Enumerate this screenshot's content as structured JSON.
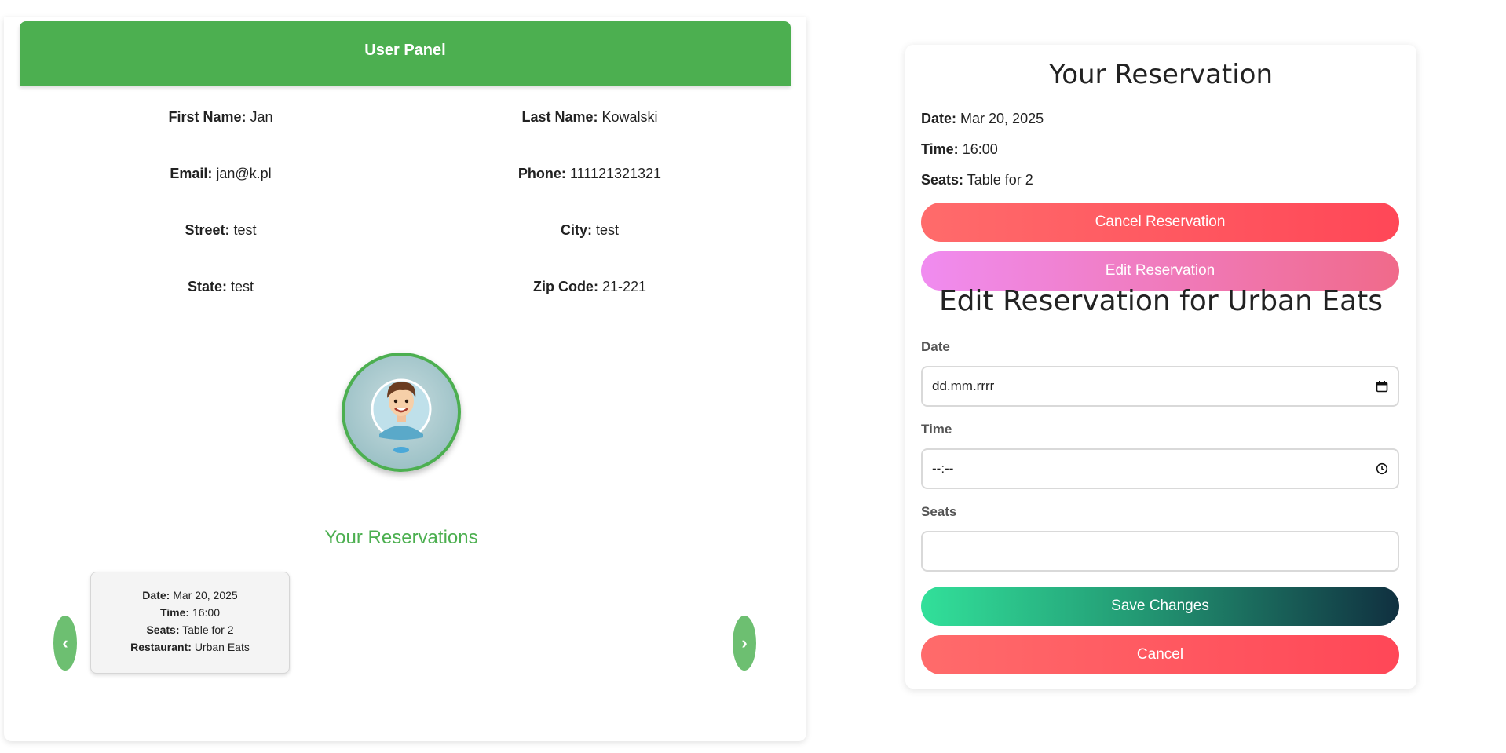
{
  "user_panel": {
    "header": "User Panel",
    "fields": [
      {
        "label": "First Name:",
        "value": "Jan"
      },
      {
        "label": "Last Name:",
        "value": "Kowalski"
      },
      {
        "label": "Email:",
        "value": "jan@k.pl"
      },
      {
        "label": "Phone:",
        "value": "111121321321"
      },
      {
        "label": "Street:",
        "value": "test"
      },
      {
        "label": "City:",
        "value": "test"
      },
      {
        "label": "State:",
        "value": "test"
      },
      {
        "label": "Zip Code:",
        "value": "21-221"
      }
    ],
    "reservations_title": "Your Reservations",
    "prev_icon": "‹",
    "next_icon": "›",
    "card": {
      "date_label": "Date:",
      "date": "Mar 20, 2025",
      "time_label": "Time:",
      "time": "16:00",
      "seats_label": "Seats:",
      "seats": "Table for 2",
      "restaurant_label": "Restaurant:",
      "restaurant": "Urban Eats"
    }
  },
  "reservation": {
    "title": "Your Reservation",
    "date_label": "Date:",
    "date": "Mar 20, 2025",
    "time_label": "Time:",
    "time": "16:00",
    "seats_label": "Seats:",
    "seats": "Table for 2",
    "cancel_reservation": "Cancel Reservation",
    "edit_reservation": "Edit Reservation"
  },
  "edit_form": {
    "title": "Edit Reservation for Urban Eats",
    "date_label": "Date",
    "date_placeholder": "dd.mm.rrrr",
    "time_label": "Time",
    "time_placeholder": "--:--",
    "seats_label": "Seats",
    "seats_value": "",
    "save": "Save Changes",
    "cancel": "Cancel"
  },
  "colors": {
    "primary_green": "#4caf50",
    "cancel_red": "#ff4757",
    "edit_pink": "#f08cf0",
    "save_green": "#32e09a"
  }
}
